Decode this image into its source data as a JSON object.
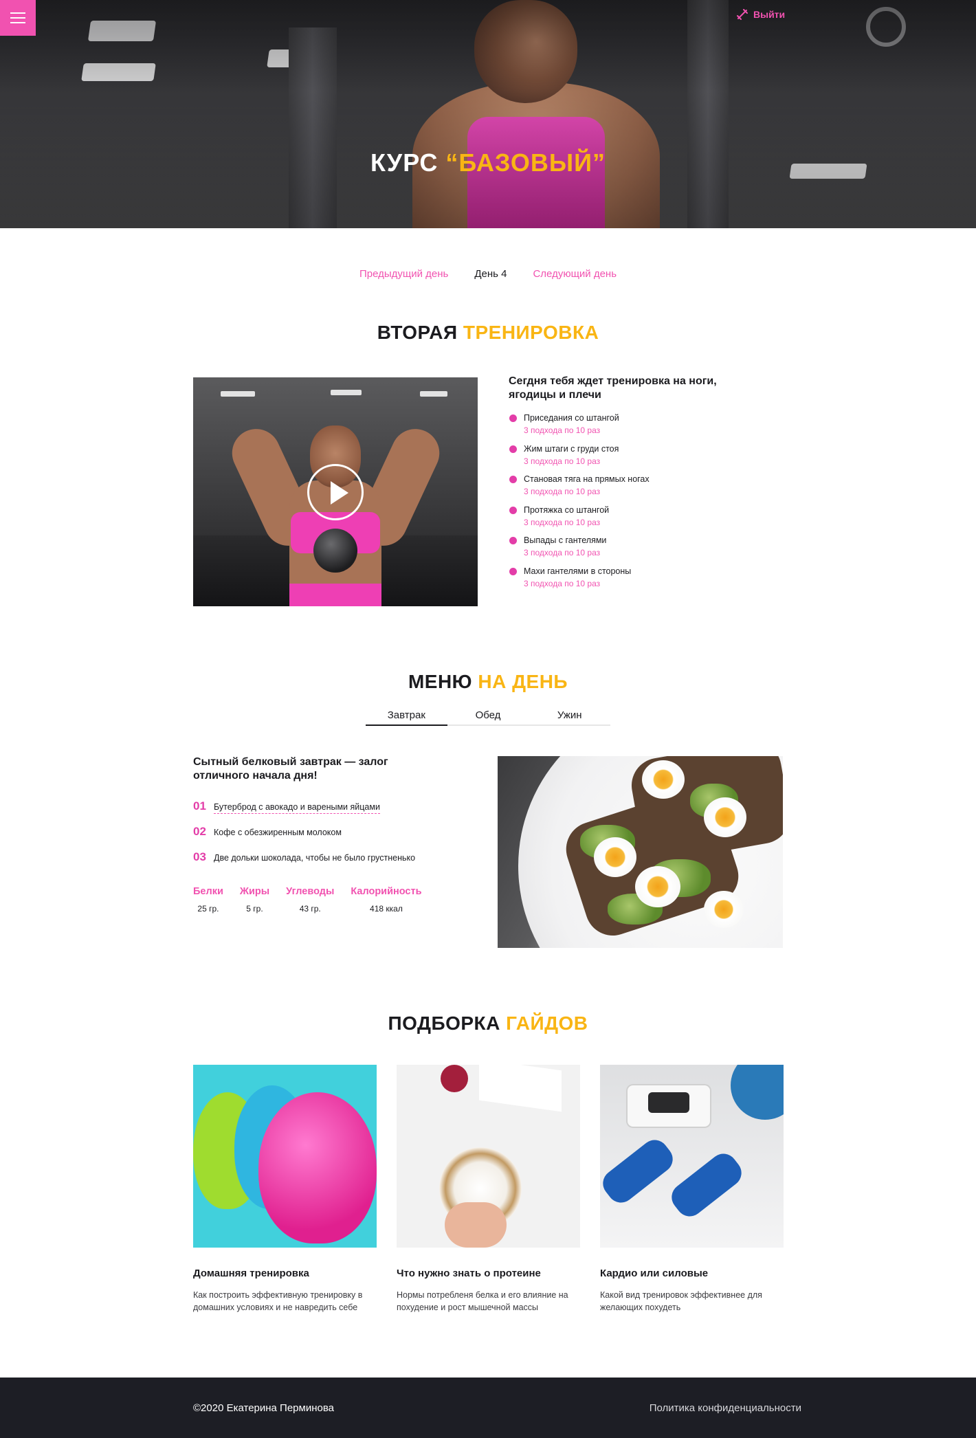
{
  "header": {
    "menu_icon": "hamburger-icon",
    "logout_icon": "dumbbell-icon",
    "logout_label": "Выйти",
    "title_prefix": "КУРС",
    "title_accent": "“БАЗОВЫЙ”"
  },
  "day_nav": {
    "prev": "Предыдущий день",
    "current": "День 4",
    "next": "Следующий день"
  },
  "workout": {
    "title_main": "ВТОРАЯ",
    "title_accent": "ТРЕНИРОВКА",
    "play_icon": "play-icon",
    "intro": "Сегдня тебя ждет тренировка на ноги, ягодицы и плечи",
    "exercises": [
      {
        "name": "Приседания со штангой",
        "sets": "3 подхода по 10 раз"
      },
      {
        "name": "Жим штаги с груди стоя",
        "sets": "3 подхода по 10 раз"
      },
      {
        "name": "Становая тяга на прямых ногах",
        "sets": "3 подхода по 10 раз"
      },
      {
        "name": "Протяжка со штангой",
        "sets": "3 подхода по 10 раз"
      },
      {
        "name": "Выпады с гантелями",
        "sets": "3 подхода по 10 раз"
      },
      {
        "name": "Махи гантелями в стороны",
        "sets": "3 подхода по 10 раз"
      }
    ]
  },
  "menu": {
    "title_main": "МЕНЮ",
    "title_accent": "НА ДЕНЬ",
    "tabs": [
      "Завтрак",
      "Обед",
      "Ужин"
    ],
    "intro": "Сытный белковый завтрак — залог отличного начала дня!",
    "items": [
      {
        "num": "01",
        "text": "Бутерброд с авокадо и вареными яйцами"
      },
      {
        "num": "02",
        "text": "Кофе с обезжиренным молоком"
      },
      {
        "num": "03",
        "text": "Две дольки шоколада, чтобы не было грустненько"
      }
    ],
    "macros": [
      {
        "label": "Белки",
        "value": "25 гр."
      },
      {
        "label": "Жиры",
        "value": "5 гр."
      },
      {
        "label": "Углеводы",
        "value": "43 гр."
      },
      {
        "label": "Калорийность",
        "value": "418 ккал"
      }
    ]
  },
  "guides": {
    "title_main": "ПОДБОРКА",
    "title_accent": "ГАЙДОВ",
    "items": [
      {
        "title": "Домашняя тренировка",
        "desc": "Как построить эффективную тренировку в домашних условиях и не навредить себе"
      },
      {
        "title": "Что нужно знать о протеине",
        "desc": "Нормы потребленя белка и его влияние на похудение и рост мышечной массы"
      },
      {
        "title": "Кардио или силовые",
        "desc": "Какой вид тренировок эффективнее для желающих похудеть"
      }
    ]
  },
  "footer": {
    "copyright": "©2020 Екатерина Перминова",
    "policy": "Политика конфиденциальности"
  },
  "colors": {
    "accent_pink": "#f152b0",
    "accent_yellow": "#f9b514",
    "footer_bg": "#1d1e25"
  }
}
